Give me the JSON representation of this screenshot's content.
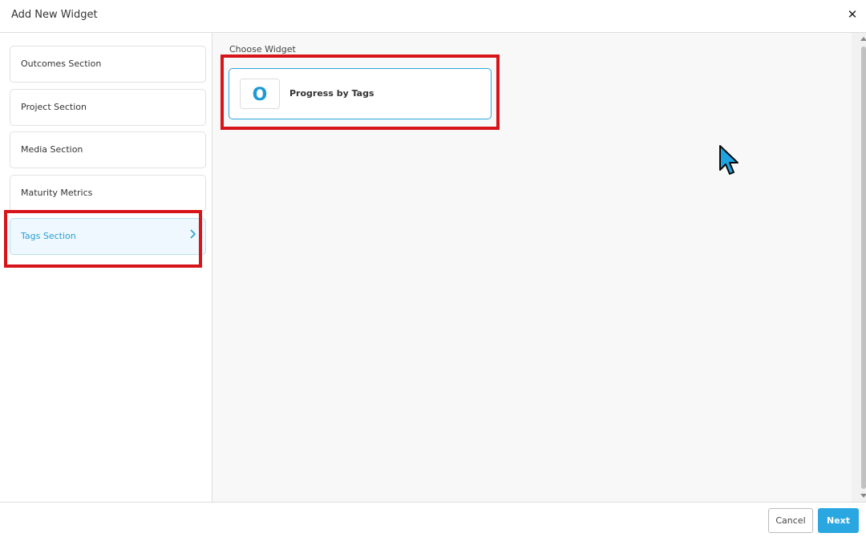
{
  "header": {
    "title": "Add New Widget",
    "close_icon": "close-icon",
    "close_glyph": "✕"
  },
  "sidebar": {
    "items": [
      {
        "label": "Outcomes Section",
        "active": false
      },
      {
        "label": "Project Section",
        "active": false
      },
      {
        "label": "Media Section",
        "active": false
      },
      {
        "label": "Maturity Metrics",
        "active": false
      },
      {
        "label": "Tags Section",
        "active": true,
        "icon": "chevron-right-icon"
      }
    ]
  },
  "main": {
    "choose_label": "Choose Widget",
    "widgets": [
      {
        "icon_letter": "O",
        "title": "Progress by Tags",
        "selected": true
      }
    ]
  },
  "footer": {
    "cancel_label": "Cancel",
    "next_label": "Next"
  },
  "colors": {
    "accent": "#2aa7e0",
    "highlight": "#d7141a",
    "active_bg": "#eef8fe"
  }
}
